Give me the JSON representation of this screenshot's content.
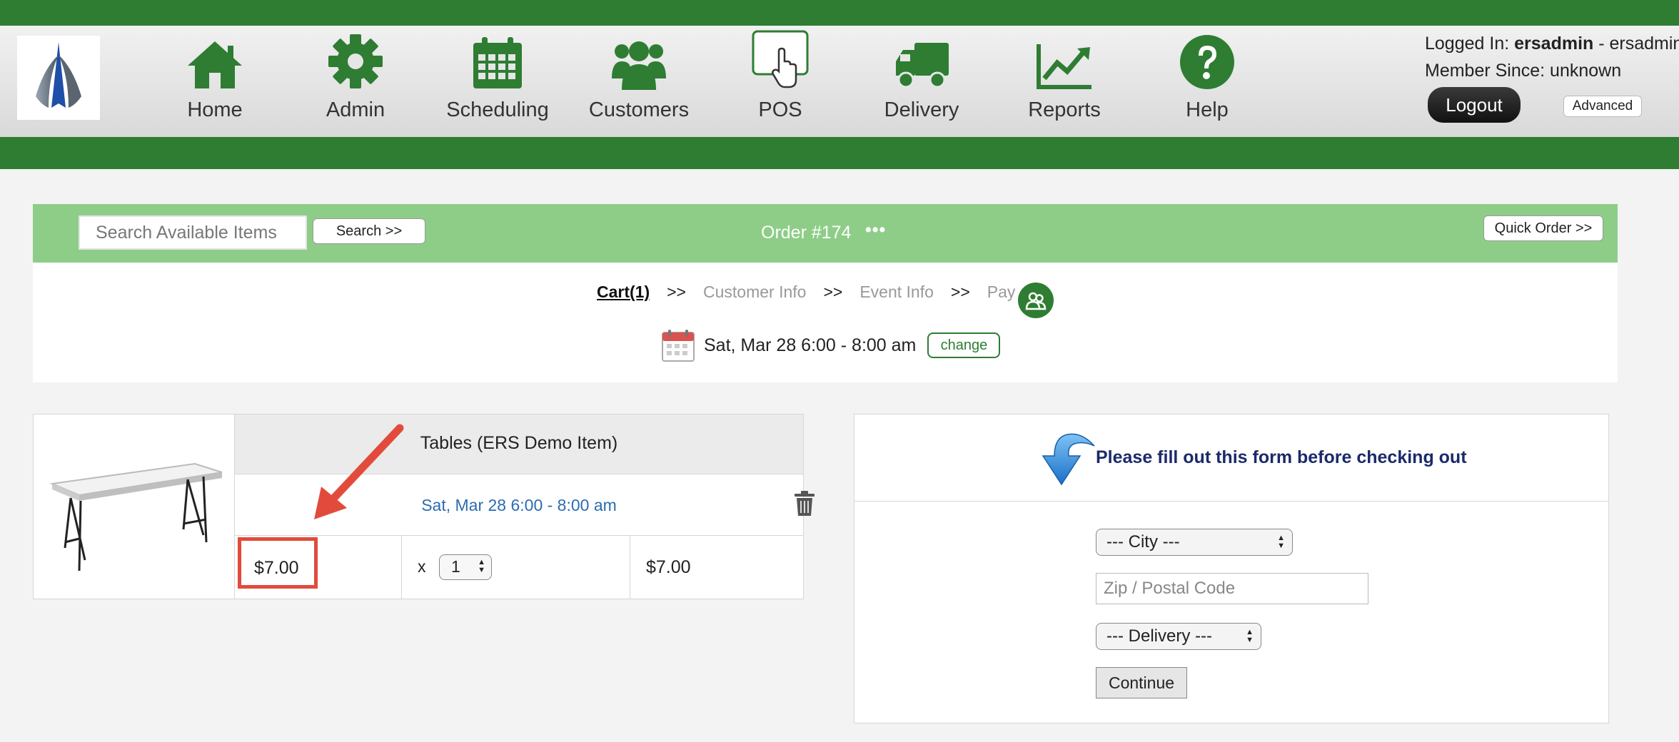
{
  "header": {
    "nav": [
      {
        "label": "Home",
        "icon": "home-icon"
      },
      {
        "label": "Admin",
        "icon": "gear-icon"
      },
      {
        "label": "Scheduling",
        "icon": "calendar-icon"
      },
      {
        "label": "Customers",
        "icon": "users-icon"
      },
      {
        "label": "POS",
        "icon": "pos-touch-icon"
      },
      {
        "label": "Delivery",
        "icon": "truck-icon"
      },
      {
        "label": "Reports",
        "icon": "chart-icon"
      },
      {
        "label": "Help",
        "icon": "help-icon"
      }
    ],
    "login_prefix": "Logged In: ",
    "login_user": "ersadmin",
    "login_suffix": " - ersadmin",
    "member_since": "Member Since: unknown",
    "logout_label": "Logout",
    "advanced_label": "Advanced",
    "brand_color": "#2e7d32"
  },
  "order_bar": {
    "search_placeholder": "Search Available Items",
    "search_button": "Search >>",
    "order_title": "Order #174",
    "order_menu": "•••",
    "quick_order": "Quick Order >>"
  },
  "steps": {
    "cart": "Cart(1)",
    "separator": ">>",
    "customer_info": "Customer Info",
    "event_info": "Event Info",
    "pay": "Pay"
  },
  "event": {
    "date_text": "Sat, Mar 28 6:00 - 8:00 am",
    "change_label": "change"
  },
  "cart": {
    "item_name": "Tables (ERS Demo Item)",
    "item_date": "Sat, Mar 28 6:00 - 8:00 am",
    "price": "$7.00",
    "qty_prefix": "x",
    "qty": "1",
    "total": "$7.00"
  },
  "checkout_form": {
    "heading": "Please fill out this form before checking out",
    "city_selected": "--- City ---",
    "zip_placeholder": "Zip / Postal Code",
    "delivery_selected": "--- Delivery ---",
    "continue_label": "Continue"
  },
  "colors": {
    "green_dark": "#2e7d32",
    "green_light": "#8ecd87",
    "annotation_red": "#e24b3c",
    "link_blue": "#2b6cb0"
  }
}
